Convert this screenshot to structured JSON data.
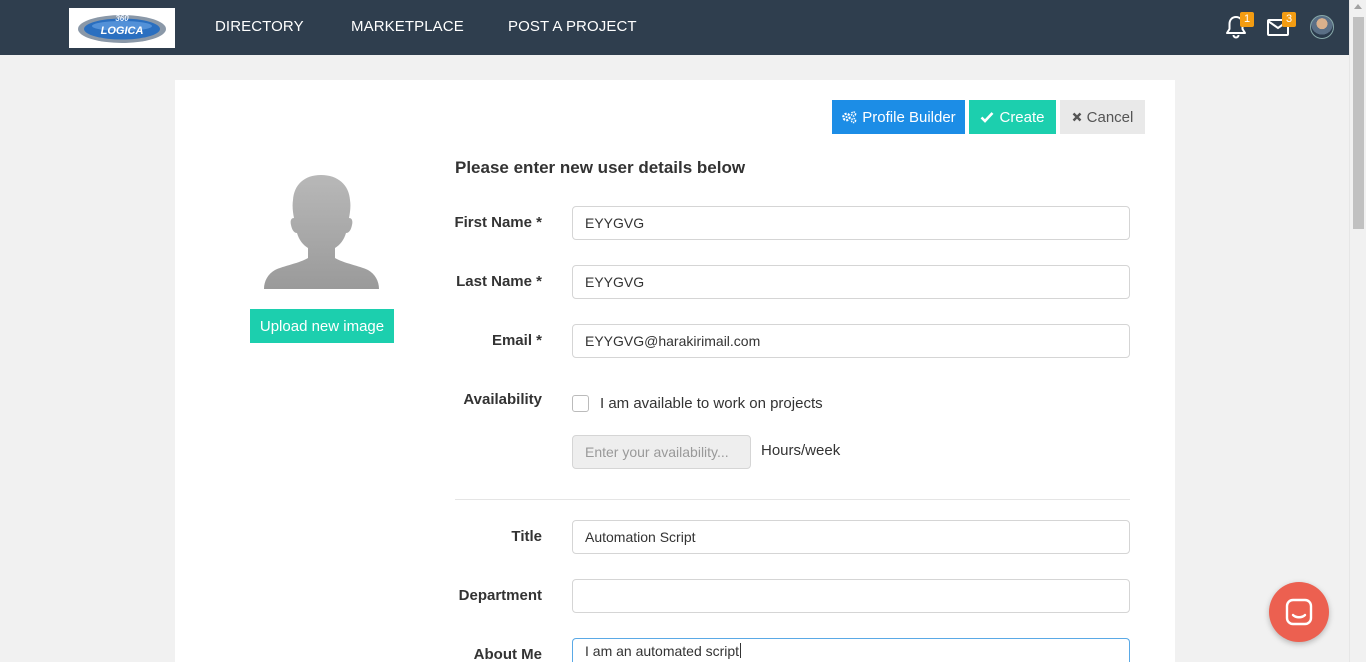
{
  "nav": {
    "logo_text": "LOGICA",
    "logo_number": "360",
    "links": [
      "DIRECTORY",
      "MARKETPLACE",
      "POST A PROJECT"
    ],
    "notifications_count": "1",
    "messages_count": "3"
  },
  "toolbar": {
    "profile_builder": "Profile Builder",
    "create": "Create",
    "cancel": "Cancel"
  },
  "profile": {
    "upload_label": "Upload new image"
  },
  "form": {
    "heading": "Please enter new user details below",
    "first_name": {
      "label": "First Name *",
      "value": "EYYGVG"
    },
    "last_name": {
      "label": "Last Name *",
      "value": "EYYGVG"
    },
    "email": {
      "label": "Email *",
      "value": "EYYGVG@harakirimail.com"
    },
    "availability": {
      "label": "Availability",
      "checkbox_label": "I am available to work on projects",
      "checked": false,
      "placeholder": "Enter your availability...",
      "unit": "Hours/week"
    },
    "title": {
      "label": "Title",
      "value": "Automation Script"
    },
    "department": {
      "label": "Department",
      "value": ""
    },
    "about_me": {
      "label": "About Me",
      "value": "I am an automated script"
    }
  },
  "colors": {
    "navbar": "#2f3e4e",
    "primary": "#1c8de6",
    "success": "#1ccfae",
    "badge": "#f39c12",
    "chat": "#ec6050"
  }
}
